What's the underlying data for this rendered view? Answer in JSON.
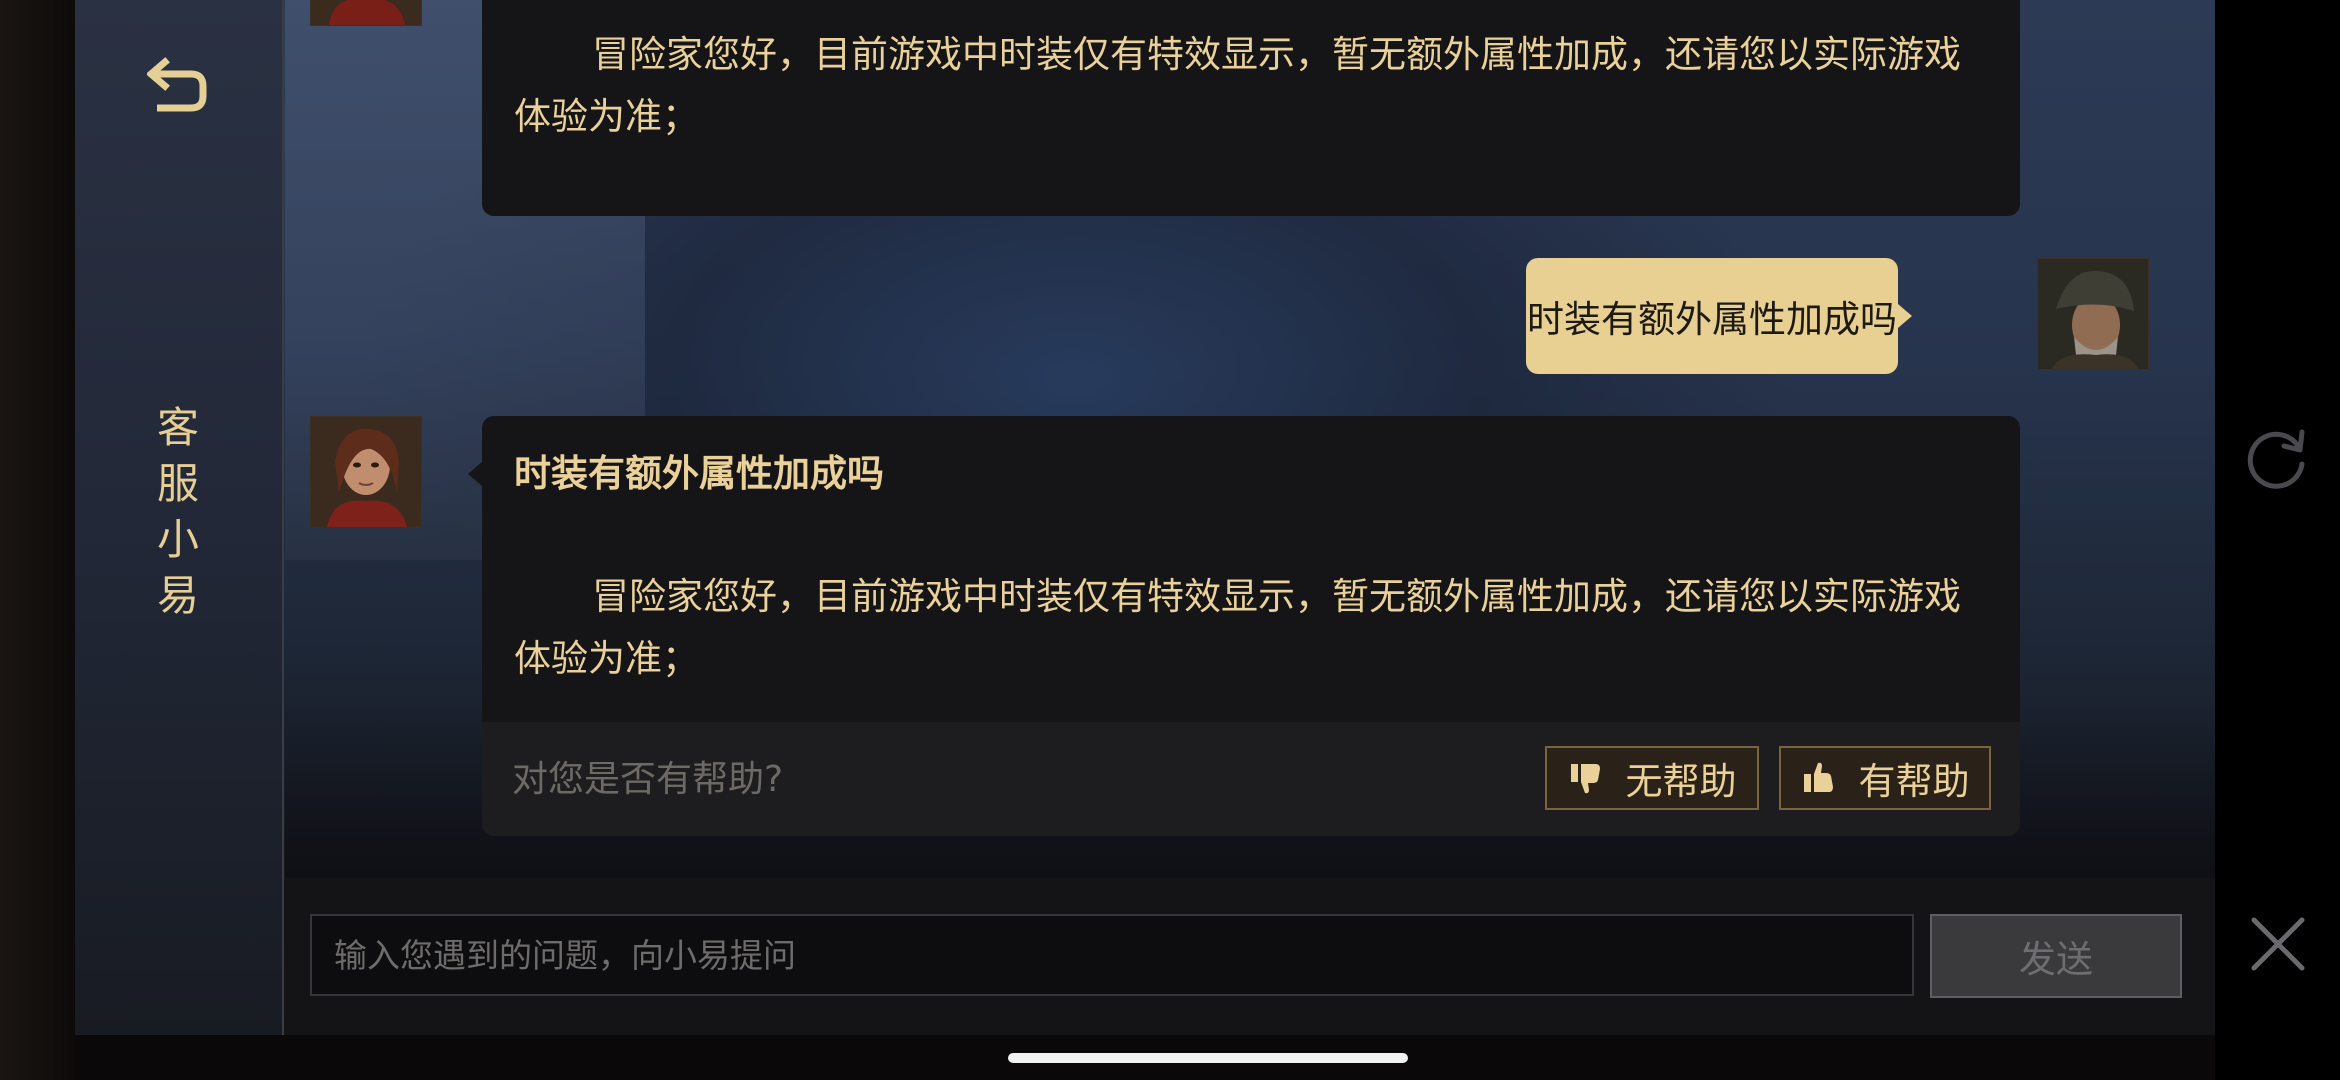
{
  "sidebar": {
    "back_icon": "back-arrow-icon",
    "title": "客服小易"
  },
  "messages": [
    {
      "role": "agent",
      "avatar": "agent-avatar",
      "text": "冒险家您好，目前游戏中时装仅有特效显示，暂无额外属性加成，还请您以实际游戏体验为准；"
    },
    {
      "role": "user",
      "avatar": "user-avatar",
      "text": "时装有额外属性加成吗"
    },
    {
      "role": "agent",
      "avatar": "agent-avatar",
      "title": "时装有额外属性加成吗",
      "text": "冒险家您好，目前游戏中时装仅有特效显示，暂无额外属性加成，还请您以实际游戏体验为准；",
      "feedback": {
        "question": "对您是否有帮助?",
        "not_helpful_label": "无帮助",
        "helpful_label": "有帮助"
      }
    }
  ],
  "input": {
    "value": "",
    "placeholder": "输入您遇到的问题，向小易提问",
    "send_label": "发送"
  },
  "controls": {
    "refresh_icon": "refresh-icon",
    "close_icon": "close-icon"
  },
  "colors": {
    "accent_gold": "#e8cf92",
    "bubble_dark": "#151416",
    "text_gold": "#e9d199"
  }
}
